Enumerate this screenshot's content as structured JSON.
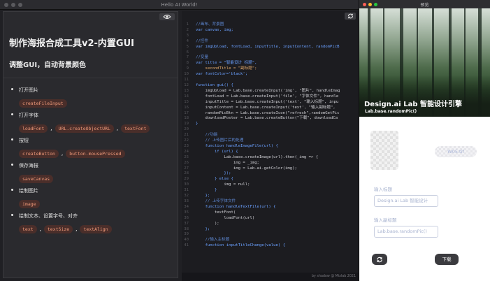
{
  "main_window": {
    "title": "Hello AI World!"
  },
  "doc": {
    "title": "制作海报合成工具v2-内置GUI",
    "subtitle": "调整GUI，自动背景颜色",
    "items": [
      {
        "label": "打开图片",
        "tags": [
          "createFileInput"
        ]
      },
      {
        "label": "打开字体",
        "tags": [
          "loadFont",
          "URL.createObjectURL",
          "textFont"
        ]
      },
      {
        "label": "按钮",
        "tags": [
          "createButton",
          "button.mousePressed"
        ]
      },
      {
        "label": "保存海报",
        "tags": [
          "saveCanvas"
        ]
      },
      {
        "label": "绘制图片",
        "tags": [
          "image"
        ]
      },
      {
        "label": "绘制文本、设置字号、对齐",
        "tags": [
          "text",
          "textSize",
          "textAlign"
        ]
      }
    ],
    "separator": ","
  },
  "code": {
    "lines": [
      {
        "n": "1",
        "t": "//画布、背景图"
      },
      {
        "n": "2",
        "t": "var canvas, img;"
      },
      {
        "n": "3",
        "t": ""
      },
      {
        "n": "4",
        "t": "//控件"
      },
      {
        "n": "5",
        "t": "var imgUpload, fontLoad, inputTitle, inputContent, randomPicB"
      },
      {
        "n": "6",
        "t": ""
      },
      {
        "n": "7",
        "t": "//变量"
      },
      {
        "n": "8",
        "t": "var title = \"智能设计 标题\","
      },
      {
        "n": "9",
        "t": "    secondTitle = \"副标题\";"
      },
      {
        "n": "10",
        "t": "var fontColor='black';"
      },
      {
        "n": "11",
        "t": ""
      },
      {
        "n": "12",
        "t": "function gui() {"
      },
      {
        "n": "13",
        "t": "    imgUpload = Lab.base.createInput('img', \"图片\", handleImag"
      },
      {
        "n": "14",
        "t": "    fontLoad = Lab.base.createInput('file', \"字体文件\", handle"
      },
      {
        "n": "15",
        "t": "    inputTitle = Lab.base.createInput('text', \"输入标题\", inpu"
      },
      {
        "n": "16",
        "t": "    inputContent = Lab.base.createInput('text', \"输入副标题\","
      },
      {
        "n": "17",
        "t": "    randomPicBtn = Lab.base.createIcon(\"refresh\",randomGetPic"
      },
      {
        "n": "18",
        "t": "    downloadPoster = Lab.base.createButton(\"下载\", downloadCa"
      },
      {
        "n": "19",
        "t": "}"
      },
      {
        "n": "20",
        "t": ""
      },
      {
        "n": "21",
        "t": "    //功能"
      },
      {
        "n": "22",
        "t": "    // 上传图片后的处理"
      },
      {
        "n": "23",
        "t": "    function handleImageFile(url) {"
      },
      {
        "n": "24",
        "t": "        if (url) {"
      },
      {
        "n": "25",
        "t": "            Lab.base.createImage(url).then(_img => {"
      },
      {
        "n": "26",
        "t": "                img = _img;"
      },
      {
        "n": "27",
        "t": "                img = Lab.ai.getColor(img);"
      },
      {
        "n": "28",
        "t": "            });"
      },
      {
        "n": "29",
        "t": "        } else {"
      },
      {
        "n": "30",
        "t": "            img = null;"
      },
      {
        "n": "31",
        "t": "        }"
      },
      {
        "n": "32",
        "t": "    };"
      },
      {
        "n": "33",
        "t": "    // 上传字体文件"
      },
      {
        "n": "34",
        "t": "    function handleTextFile(url) {"
      },
      {
        "n": "35",
        "t": "        textFont("
      },
      {
        "n": "36",
        "t": "            loadFont(url)"
      },
      {
        "n": "37",
        "t": "        );"
      },
      {
        "n": "38",
        "t": "    };"
      },
      {
        "n": "39",
        "t": ""
      },
      {
        "n": "40",
        "t": "    //输入主标题"
      },
      {
        "n": "41",
        "t": "    function inputTitleChange(value) {"
      }
    ],
    "footer": "by shadow @ Mixlab 2021"
  },
  "preview": {
    "window_title": "预览",
    "hero_title": "Design.ai Lab 智能设计引擎",
    "hero_subtitle": "Lab.base.randomPic()",
    "badge": "W05.tif",
    "title_label": "输入标题",
    "title_value": "Design.ai Lab 智能设计",
    "subtitle_label": "输入副标题",
    "subtitle_value": "Lab.base.randomPic()",
    "download_label": "下载"
  },
  "colors": {
    "tag_bg": "#4a2e2a",
    "tag_text": "#f09a7a",
    "code_comment": "#5f8ad6",
    "code_keyword": "#6aa0ff",
    "code_string": "#e0a86a"
  },
  "icons": {
    "eye": "eye-icon",
    "refresh": "refresh-icon"
  }
}
